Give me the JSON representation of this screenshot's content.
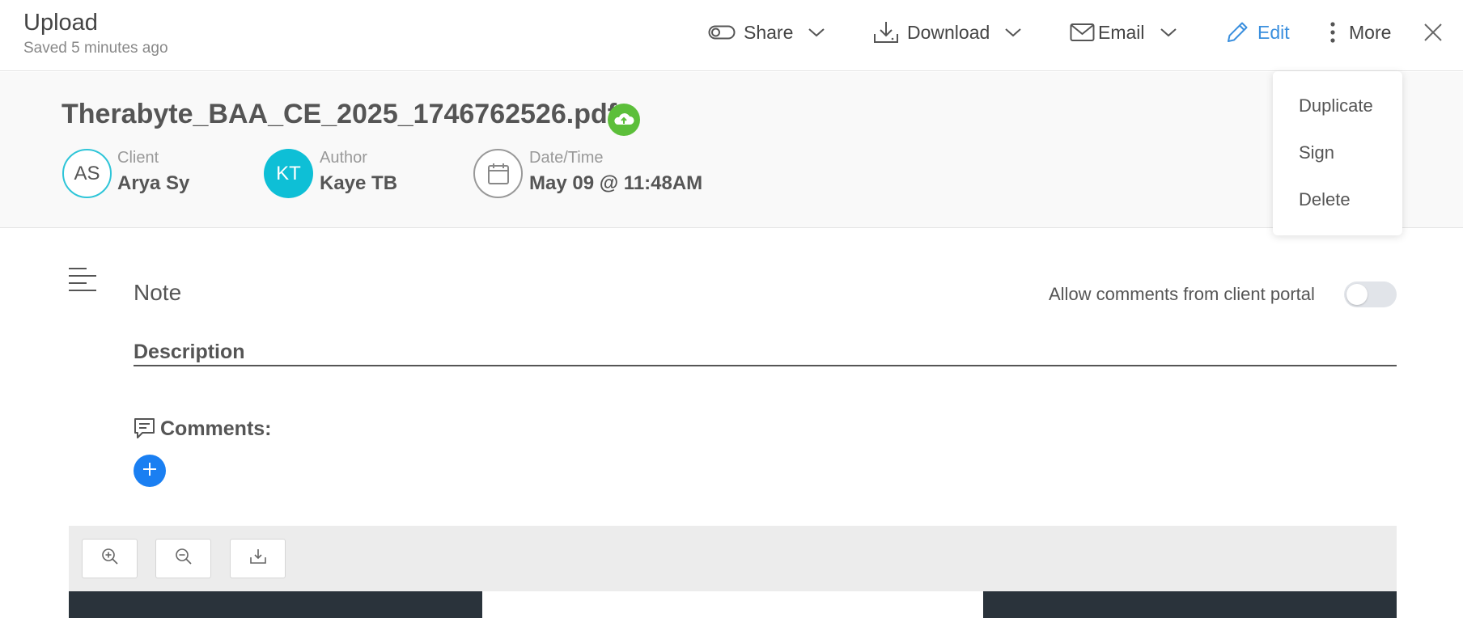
{
  "header": {
    "title": "Upload",
    "subtitle": "Saved 5 minutes ago",
    "share_label": "Share",
    "download_label": "Download",
    "email_label": "Email",
    "edit_label": "Edit",
    "more_label": "More"
  },
  "file": {
    "name": "Therabyte_BAA_CE_2025_1746762526.pdf"
  },
  "client": {
    "label": "Client",
    "initials": "AS",
    "name": "Arya Sy"
  },
  "author": {
    "label": "Author",
    "initials": "KT",
    "name": "Kaye TB"
  },
  "datetime": {
    "label": "Date/Time",
    "value": "May 09 @ 11:48AM"
  },
  "more_menu": {
    "items": [
      "Duplicate",
      "Sign",
      "Delete"
    ]
  },
  "note": {
    "title": "Note",
    "allow_comments_label": "Allow comments from client portal",
    "allow_comments_enabled": false,
    "description_label": "Description",
    "comments_label": "Comments:"
  },
  "colors": {
    "accent": "#1a7ff2",
    "edit": "#3a8fde",
    "upload_badge": "#5cbf3a",
    "author_avatar": "#0ebfd6",
    "doc_dark": "#2a333b"
  },
  "icons": [
    "toggle-icon",
    "download-icon",
    "mail-icon",
    "pencil-icon",
    "kebab-icon",
    "close-icon",
    "cloud-upload-icon",
    "calendar-icon",
    "lines-icon",
    "comment-icon",
    "plus-icon",
    "zoom-in-icon",
    "zoom-out-icon"
  ]
}
